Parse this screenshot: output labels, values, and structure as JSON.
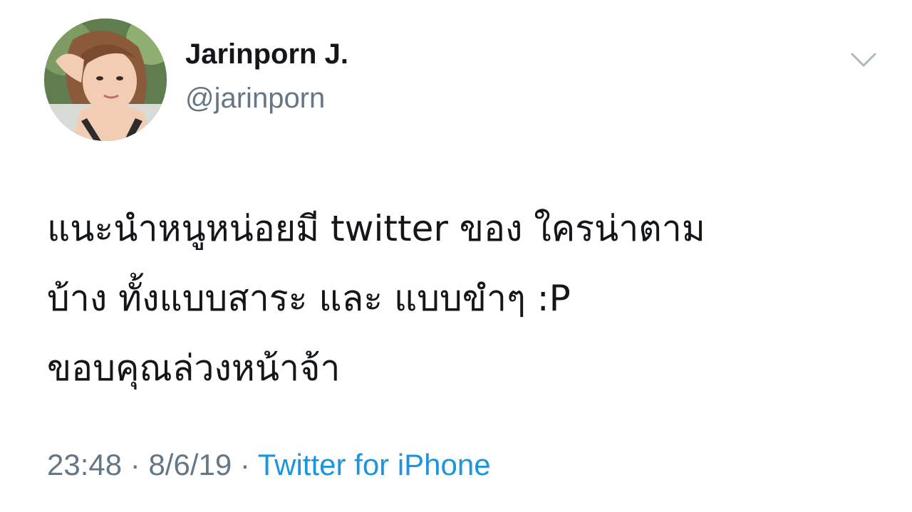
{
  "author": {
    "display_name": "Jarinporn J.",
    "handle": "@jarinporn",
    "avatar_icon": "profile-photo"
  },
  "menu": {
    "icon": "chevron-down-icon"
  },
  "tweet": {
    "lines": [
      "แนะนำหนูหน่อยมี twitter ของ ใครน่าตาม",
      "บ้าง ทั้งแบบสาระ และ แบบขำๆ :P",
      "ขอบคุณล่วงหน้าจ้า"
    ]
  },
  "meta": {
    "time": "23:48",
    "separator_1": " · ",
    "date": "8/6/19",
    "separator_2": " · ",
    "source": "Twitter for iPhone"
  },
  "colors": {
    "text_primary": "#14171a",
    "text_secondary": "#657786",
    "link": "#1b95e0",
    "chevron": "#aab8c2"
  }
}
